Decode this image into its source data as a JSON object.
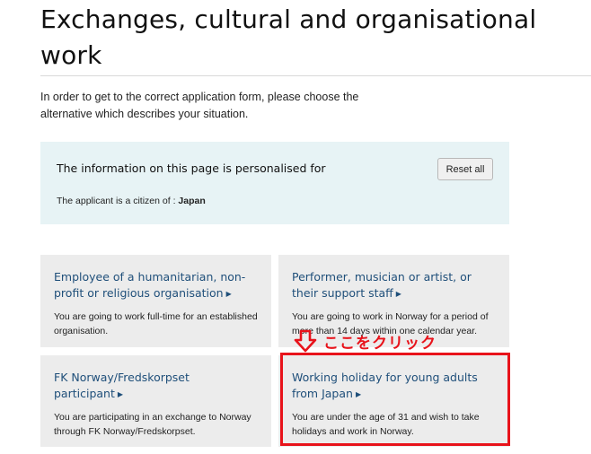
{
  "page": {
    "title": "Exchanges, cultural and organisational work",
    "intro": "In order to get to the correct application form, please choose the alternative which describes your situation."
  },
  "info_panel": {
    "heading": "The information on this page is personalised for",
    "reset_label": "Reset all",
    "citizen_prefix": "The applicant is a citizen of : ",
    "citizen_country": "Japan"
  },
  "cards": [
    {
      "title": "Employee of a humanitarian, non-profit or religious organisation",
      "description": "You are going to work full-time for an established organisation."
    },
    {
      "title": "Performer, musician or artist, or their support staff",
      "description": "You are going to work in Norway for a period of more than 14 days within one calendar year."
    },
    {
      "title": "FK Norway/Fredskorpset participant",
      "description": "You are participating in an exchange to Norway through FK Norway/Fredskorpset."
    },
    {
      "title": "Working holiday for young adults from Japan",
      "description": "You are under the age of 31 and wish to take holidays and work in Norway."
    }
  ],
  "annotation": {
    "text": "ここをクリック",
    "color": "#e8131b"
  },
  "icons": {
    "caret": "caret-right-icon",
    "arrow": "arrow-down-icon"
  }
}
